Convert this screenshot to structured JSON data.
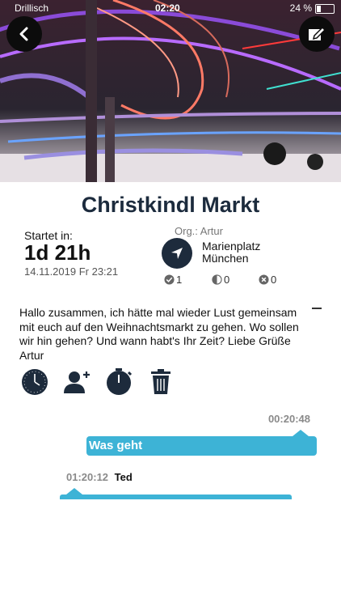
{
  "status_bar": {
    "carrier": "Drillisch",
    "time": "02:20",
    "battery": "24 %"
  },
  "event": {
    "title": "Christkindl Markt",
    "starts_label": "Startet in:",
    "countdown": "1d 21h",
    "datetime": "14.11.2019 Fr 23:21",
    "organizer": "Org.: Artur",
    "location_line1": "Marienplatz",
    "location_line2": "München",
    "rsvp": {
      "yes": "1",
      "maybe": "0",
      "no": "0"
    },
    "description": "Hallo zusammen, ich hätte mal wieder Lust gemeinsam mit euch auf den Weihnachtsmarkt zu gehen. Wo sollen wir hin gehen? Und wann habt's Ihr Zeit? Liebe Grüße Artur"
  },
  "actions": [
    "clock-icon",
    "add-person-icon",
    "timer-icon",
    "trash-icon"
  ],
  "chat": {
    "messages": [
      {
        "time": "00:20:48",
        "author": "",
        "text": "Was geht",
        "side": "right"
      },
      {
        "time": "01:20:12",
        "author": "Ted",
        "text": "",
        "side": "left"
      }
    ]
  },
  "colors": {
    "accent": "#3db3d6",
    "dark": "#1c2b3d"
  }
}
